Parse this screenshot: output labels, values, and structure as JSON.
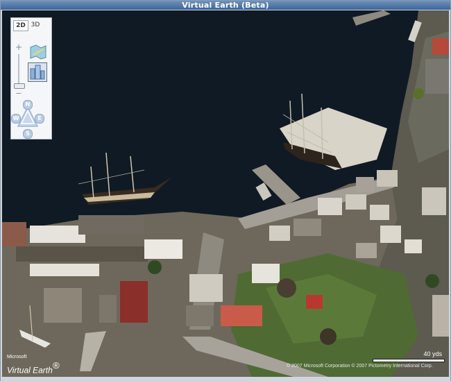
{
  "window": {
    "title": "Virtual Earth (Beta)"
  },
  "nav_control": {
    "mode_2d": "2D",
    "mode_3d": "3D",
    "selected_mode": "2D",
    "zoom_in": "+",
    "zoom_out": "−",
    "compass": {
      "north": "N",
      "south": "S",
      "west": "W",
      "east": "E"
    },
    "selected_view": "aerial"
  },
  "map": {
    "logo_small": "Microsoft",
    "logo_main": "Virtual Earth",
    "logo_mark": "®",
    "scale_label": "40 yds",
    "copyright": "© 2007 Microsoft Corporation  © 2007 Pictometry International Corp."
  },
  "colors": {
    "water": "#0f1a24",
    "grass": "#4f6b33",
    "roof_red": "#8a2f2a",
    "titlebar": "#4a72a3"
  }
}
